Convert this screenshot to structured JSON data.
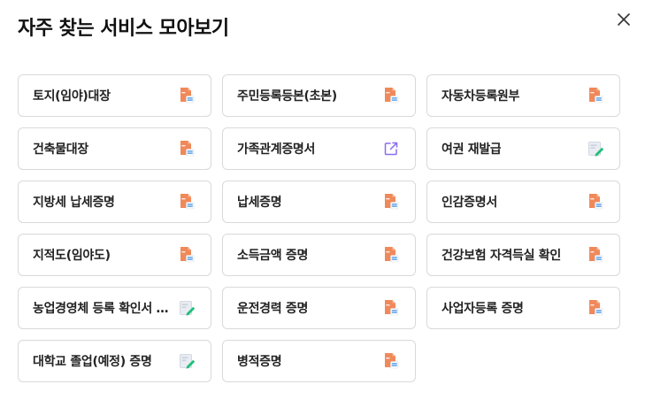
{
  "title": "자주 찾는 서비스 모아보기",
  "colors": {
    "pdf_orange": "#f0895a",
    "pdf_blue": "#3b8fe6",
    "link_purple": "#8b6cf0",
    "edit_green": "#1fbf7a",
    "border": "#d9d9d9"
  },
  "services": [
    {
      "label": "토지(임야)대장",
      "icon": "pdf-document-icon"
    },
    {
      "label": "주민등록등본(초본)",
      "icon": "pdf-document-icon"
    },
    {
      "label": "자동차등록원부",
      "icon": "pdf-document-icon"
    },
    {
      "label": "건축물대장",
      "icon": "pdf-document-icon"
    },
    {
      "label": "가족관계증명서",
      "icon": "external-link-icon"
    },
    {
      "label": "여권 재발급",
      "icon": "edit-form-icon"
    },
    {
      "label": "지방세 납세증명",
      "icon": "pdf-document-icon"
    },
    {
      "label": "납세증명",
      "icon": "pdf-document-icon"
    },
    {
      "label": "인감증명서",
      "icon": "pdf-document-icon"
    },
    {
      "label": "지적도(임야도)",
      "icon": "pdf-document-icon"
    },
    {
      "label": "소득금액 증명",
      "icon": "pdf-document-icon"
    },
    {
      "label": "건강보험 자격득실 확인",
      "icon": "pdf-document-icon"
    },
    {
      "label": "농업경영체 등록 확인서 …",
      "icon": "edit-form-icon"
    },
    {
      "label": "운전경력 증명",
      "icon": "pdf-document-icon"
    },
    {
      "label": "사업자등록 증명",
      "icon": "pdf-document-icon"
    },
    {
      "label": "대학교 졸업(예정) 증명",
      "icon": "edit-form-icon"
    },
    {
      "label": "병적증명",
      "icon": "pdf-document-icon"
    }
  ]
}
